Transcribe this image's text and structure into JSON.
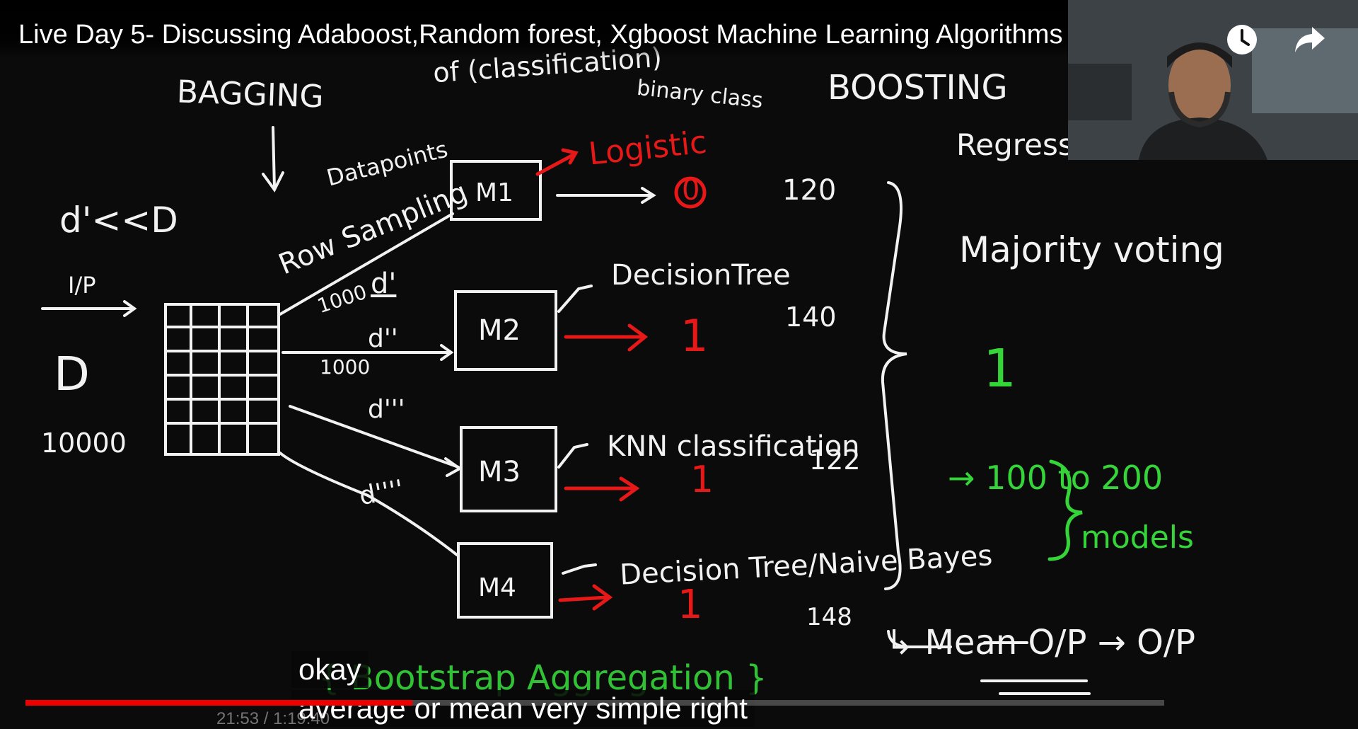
{
  "video": {
    "title": "Live Day 5- Discussing Adaboost,Random forest, Xgboost Machine Learning Algorithms",
    "watch_later_icon": "clock-icon",
    "share_icon": "share-arrow-icon"
  },
  "board": {
    "bagging": "BAGGING",
    "classification_note": "of (classification)",
    "binary_class": "binary class",
    "boosting": "BOOSTING",
    "regression": "Regression",
    "datapoints": "Datapoints",
    "row_sampling": "Row Sampling",
    "d_prime_lt_d": "d'<<D",
    "dataset_label": "D",
    "dataset_count": "10000",
    "input_label": "I/P",
    "m1": "M1",
    "m2": "M2",
    "m3": "M3",
    "m4": "M4",
    "logistic": "Logistic",
    "decision_tree": "DecisionTree",
    "knn": "KNN classification",
    "dt_naive": "Decision Tree/Naive Bayes",
    "d1": "d'",
    "d2": "d''",
    "d3": "d'''",
    "d4": "d''''",
    "n1": "1000",
    "n2": "1000",
    "out1": "0",
    "out2": "1",
    "out3": "1",
    "out4": "1",
    "v120": "120",
    "v140": "140",
    "v122": "122",
    "v148": "148",
    "majority_voting": "Majority voting",
    "majority_result": "1",
    "models_range": "→ 100 to 200",
    "models_word": "models",
    "mean_op": "↳ Mean O/P → O/P",
    "bootstrap": "{ Bootstrap Aggregation }"
  },
  "captions": {
    "line1": "okay",
    "line2": "average or mean very simple right"
  },
  "player": {
    "time": "21:53 / 1:19:40",
    "progress": 0.34
  },
  "colors": {
    "board": "#0b0b0b",
    "chalk": "#f2f2f2",
    "red": "#e61818",
    "green": "#35d53a"
  }
}
